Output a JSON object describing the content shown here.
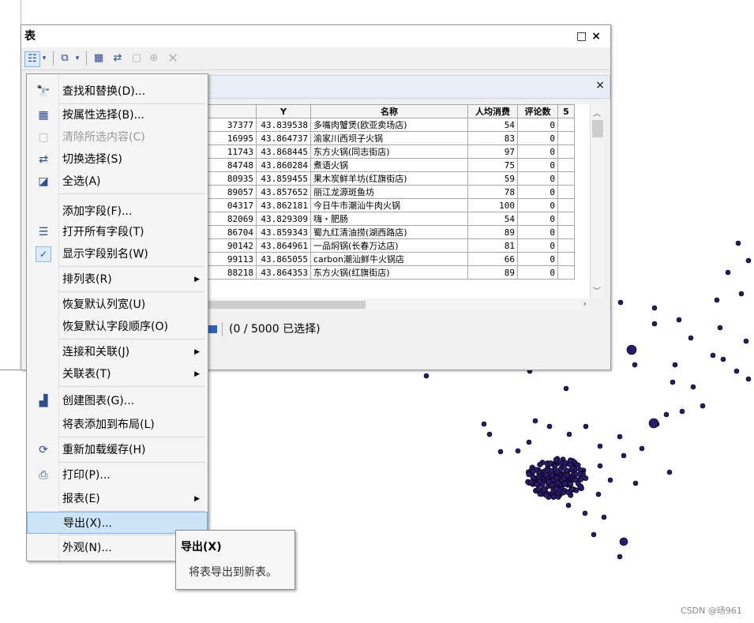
{
  "window": {
    "title": "表",
    "restore_symbol": "□",
    "close_symbol": "×"
  },
  "tab": {
    "close_symbol": "×"
  },
  "toolbar": {
    "icons": [
      "table-options-icon",
      "dropdown-arrow-icon",
      "relate-icon",
      "dropdown-arrow-icon",
      "select-by-attributes-icon",
      "switch-selection-icon",
      "clear-selection-icon",
      "zoom-selected-icon",
      "delete-selected-icon"
    ]
  },
  "table": {
    "columns": [
      "",
      "Y",
      "名称",
      "人均消费",
      "评论数",
      "5"
    ],
    "rows": [
      [
        "37377",
        "43.839538",
        "多嘴肉蟹煲(欧亚卖场店)",
        "54",
        "0"
      ],
      [
        "16995",
        "43.864737",
        "渝家川西坝子火锅",
        "83",
        "0"
      ],
      [
        "11743",
        "43.868445",
        "东方火锅(同志街店)",
        "97",
        "0"
      ],
      [
        "84748",
        "43.860284",
        "煮语火锅",
        "75",
        "0"
      ],
      [
        "80935",
        "43.859455",
        "果木炭鲜羊坊(红旗街店)",
        "59",
        "0"
      ],
      [
        "89057",
        "43.857652",
        "丽江龙源斑鱼坊",
        "78",
        "0"
      ],
      [
        "04317",
        "43.862181",
        "今日牛市潮汕牛肉火锅",
        "100",
        "0"
      ],
      [
        "82069",
        "43.829309",
        "嗨・肥肠",
        "54",
        "0"
      ],
      [
        "86704",
        "43.859343",
        "蜀九红清油捞(湖西路店)",
        "89",
        "0"
      ],
      [
        "90142",
        "43.864961",
        "一品焖锅(长春万达店)",
        "81",
        "0"
      ],
      [
        "99113",
        "43.865055",
        "carbon潮汕鲜牛火锅店",
        "66",
        "0"
      ],
      [
        "88218",
        "43.864353",
        "东方火锅(红旗街店)",
        "89",
        "0"
      ]
    ]
  },
  "status": {
    "selection_text": "(0 / 5000 已选择)"
  },
  "menu": {
    "items": [
      {
        "label": "查找和替换(D)...",
        "icon": "binoculars-icon",
        "glyph": "🔭"
      },
      {
        "label": "按属性选择(B)...",
        "icon": "select-by-attributes-icon",
        "glyph": "▦"
      },
      {
        "label": "清除所选内容(C)",
        "icon": "clear-selection-icon",
        "glyph": "▢"
      },
      {
        "label": "切换选择(S)",
        "icon": "switch-selection-icon",
        "glyph": "⇄"
      },
      {
        "label": "全选(A)",
        "icon": "select-all-icon",
        "glyph": "◪"
      },
      {
        "label": "添加字段(F)...",
        "icon": "",
        "glyph": ""
      },
      {
        "label": "打开所有字段(T)",
        "icon": "list-fields-icon",
        "glyph": "☰"
      },
      {
        "label": "显示字段别名(W)",
        "icon": "checkmark-icon",
        "glyph": "✓"
      },
      {
        "label": "排列表(R)",
        "icon": "",
        "glyph": ""
      },
      {
        "label": "恢复默认列宽(U)",
        "icon": "",
        "glyph": ""
      },
      {
        "label": "恢复默认字段顺序(O)",
        "icon": "",
        "glyph": ""
      },
      {
        "label": "连接和关联(J)",
        "icon": "",
        "glyph": ""
      },
      {
        "label": "关联表(T)",
        "icon": "",
        "glyph": ""
      },
      {
        "label": "创建图表(G)...",
        "icon": "bar-chart-icon",
        "glyph": "▟"
      },
      {
        "label": "将表添加到布局(L)",
        "icon": "",
        "glyph": ""
      },
      {
        "label": "重新加载缓存(H)",
        "icon": "refresh-icon",
        "glyph": "⟳"
      },
      {
        "label": "打印(P)...",
        "icon": "printer-icon",
        "glyph": "⎙"
      },
      {
        "label": "报表(E)",
        "icon": "",
        "glyph": ""
      },
      {
        "label": "导出(X)...",
        "icon": "",
        "glyph": ""
      },
      {
        "label": "外观(N)...",
        "icon": "",
        "glyph": ""
      }
    ],
    "submenu_arrow": "▶"
  },
  "tooltip": {
    "title": "导出(X)",
    "description": "将表导出到新表。"
  },
  "watermark": "CSDN @旸961",
  "colors": {
    "point_fill": "#2a1a6b",
    "highlight": "#cde4f7"
  }
}
